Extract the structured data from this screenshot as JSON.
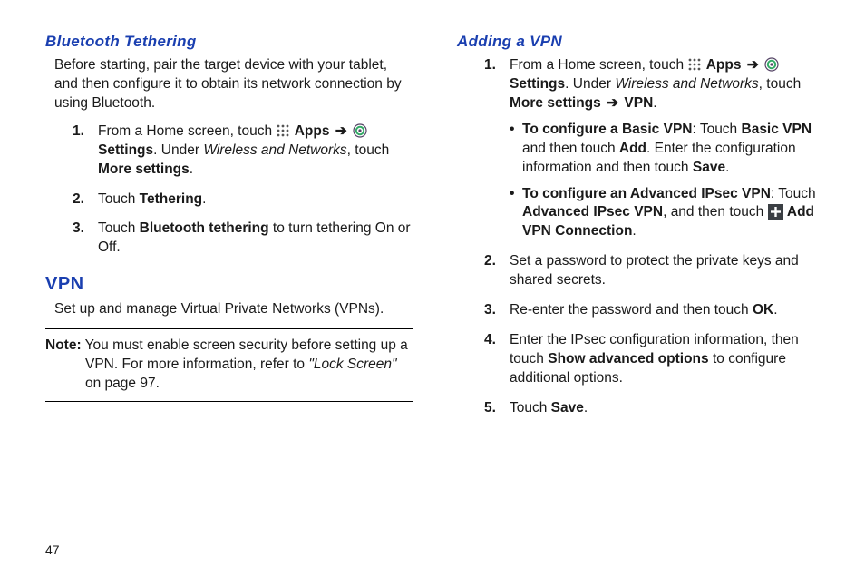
{
  "pagenum": "47",
  "left": {
    "bt_heading": "Bluetooth Tethering",
    "bt_intro": "Before starting, pair the target device with your tablet, and then configure it to obtain its network connection by using Bluetooth.",
    "bt_step1_a": "From a Home screen, touch ",
    "bt_step1_apps": "Apps",
    "bt_step1_settings": "Settings",
    "bt_step1_b_under": "Under ",
    "bt_step1_wan": "Wireless and Networks",
    "bt_step1_touch": ", touch ",
    "bt_step1_more": "More settings",
    "bt_step2_touch": "Touch ",
    "bt_step2_tethering": "Tethering",
    "bt_step3_touch": "Touch ",
    "bt_step3_bt": "Bluetooth tethering",
    "bt_step3_end": " to turn tethering On or Off.",
    "vpn_heading": "VPN",
    "vpn_intro": "Set up and manage Virtual Private Networks (VPNs).",
    "note_label": "Note:",
    "note_body_a": " You must enable screen security before setting up a VPN. For more information, refer to ",
    "note_ref": "\"Lock Screen\"",
    "note_body_b": " on page 97."
  },
  "right": {
    "add_heading": "Adding a VPN",
    "s1_a": "From a Home screen, touch ",
    "s1_apps": "Apps",
    "s1_settings": "Settings",
    "s1_under": "Under ",
    "s1_wan": "Wireless and Networks",
    "s1_touch": ", touch ",
    "s1_more": "More settings ",
    "s1_vpn": "VPN",
    "b1_label": "To configure a Basic VPN",
    "b1_a": ": Touch ",
    "b1_basic": "Basic VPN",
    "b1_b": " and then touch ",
    "b1_add": "Add",
    "b1_c": ". Enter the configuration information and then touch ",
    "b1_save": "Save",
    "b2_label": "To configure an Advanced IPsec VPN",
    "b2_a": ": Touch ",
    "b2_adv": "Advanced IPsec VPN",
    "b2_b": ", and then touch ",
    "b2_addvpn": "Add VPN Connection",
    "s2": "Set a password to protect the private keys and shared secrets.",
    "s3_a": "Re-enter the password and then touch ",
    "s3_ok": "OK",
    "s4_a": "Enter the IPsec configuration information, then touch ",
    "s4_show": "Show advanced options",
    "s4_b": " to configure additional options.",
    "s5_a": "Touch ",
    "s5_save": "Save"
  }
}
